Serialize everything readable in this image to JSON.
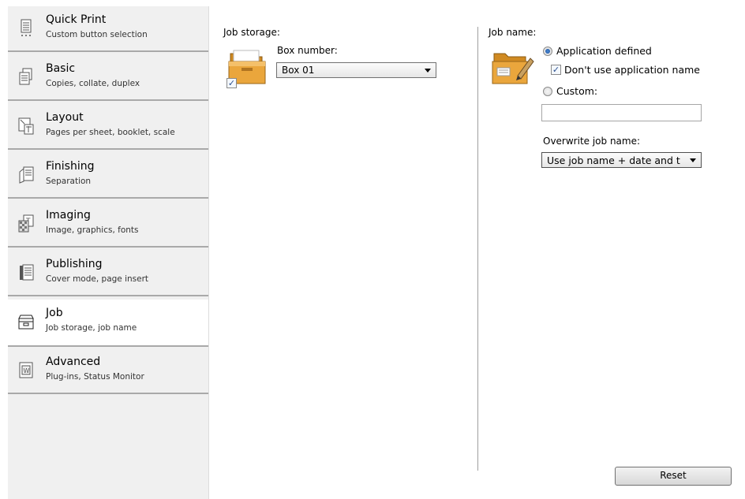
{
  "sidebar": {
    "items": [
      {
        "title": "Quick Print",
        "subtitle": "Custom button selection",
        "icon": "quick-print-icon"
      },
      {
        "title": "Basic",
        "subtitle": "Copies, collate, duplex",
        "icon": "basic-icon"
      },
      {
        "title": "Layout",
        "subtitle": "Pages per sheet, booklet, scale",
        "icon": "layout-icon"
      },
      {
        "title": "Finishing",
        "subtitle": "Separation",
        "icon": "finishing-icon"
      },
      {
        "title": "Imaging",
        "subtitle": "Image, graphics, fonts",
        "icon": "imaging-icon"
      },
      {
        "title": "Publishing",
        "subtitle": "Cover mode, page insert",
        "icon": "publishing-icon"
      },
      {
        "title": "Job",
        "subtitle": "Job storage, job name",
        "icon": "job-icon",
        "active": true
      },
      {
        "title": "Advanced",
        "subtitle": "Plug-ins, Status Monitor",
        "icon": "advanced-icon"
      }
    ]
  },
  "job_storage": {
    "label": "Job storage:",
    "box_number_label": "Box number:",
    "box_number_value": "Box 01",
    "enabled": true
  },
  "job_name": {
    "label": "Job name:",
    "option_application": "Application defined",
    "dont_use_app_name": "Don't use application name",
    "option_custom": "Custom:",
    "custom_value": "",
    "overwrite_label": "Overwrite job name:",
    "overwrite_value": "Use job name + date and t"
  },
  "reset_label": "Reset",
  "colors": {
    "folder": "#e8a43a",
    "accent": "#1d4f96",
    "sidebar_bg": "#f0f0f0"
  }
}
